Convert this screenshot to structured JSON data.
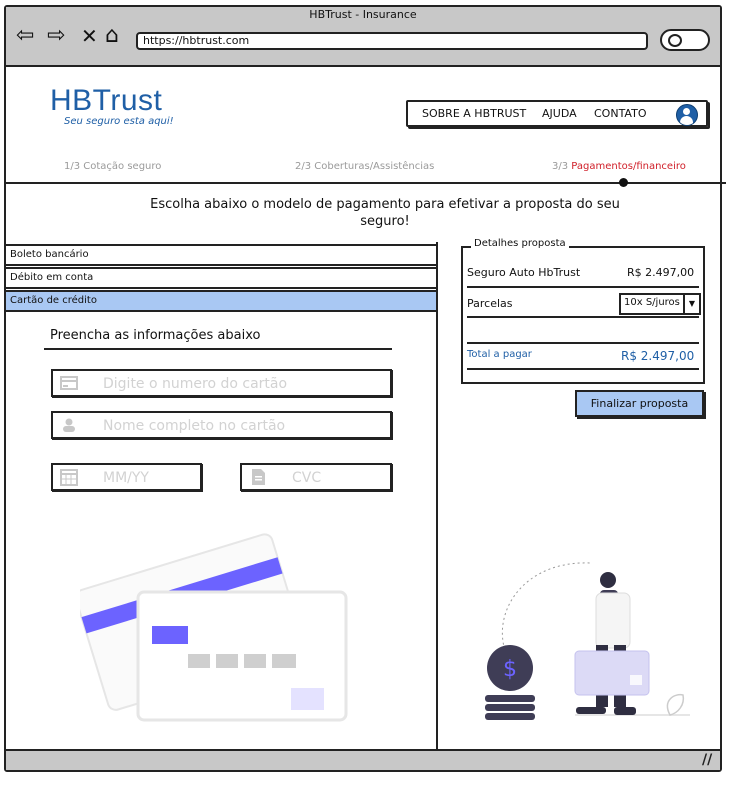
{
  "window": {
    "title": "HBTrust - Insurance",
    "url": "https://hbtrust.com"
  },
  "nav_icons": {
    "back": "back-arrow-icon",
    "forward": "forward-arrow-icon",
    "stop": "close-icon",
    "home": "home-icon",
    "search": "search-icon"
  },
  "brand": {
    "name": "HBTrust",
    "tagline": "Seu seguro esta aqui!",
    "color": "#1f5fa6"
  },
  "topnav": {
    "items": [
      "SOBRE A HBTRUST",
      "AJUDA",
      "CONTATO"
    ],
    "user_icon": "user-icon"
  },
  "steps": {
    "step1": "1/3 Cotação seguro",
    "step2": "2/3 Coberturas/Assistências",
    "step3_prefix": "3/3",
    "step3_label": "Pagamentos/financeiro",
    "active_color": "#d0202a"
  },
  "instruction": "Escolha abaixo o modelo de pagamento para efetivar a proposta do seu seguro!",
  "payment_options": [
    "Boleto bancário",
    "Débito em conta",
    "Cartão de crédito"
  ],
  "selected_payment": "Cartão de crédito",
  "form": {
    "title": "Preencha as informações abaixo",
    "card_number_placeholder": "Digite o numero do cartão",
    "card_name_placeholder": "Nome completo no cartão",
    "expiry_placeholder": "MM/YY",
    "cvc_placeholder": "CVC"
  },
  "details": {
    "legend": "Detalhes proposta",
    "product_label": "Seguro Auto HbTrust",
    "product_value": "R$ 2.497,00",
    "installments_label": "Parcelas",
    "installments_value": "10x S/juros",
    "total_label": "Total a pagar",
    "total_value": "R$ 2.497,00"
  },
  "finalize_button": "Finalizar proposta",
  "colors": {
    "highlight": "#a9c8f3",
    "illustration": "#6c63ff"
  }
}
